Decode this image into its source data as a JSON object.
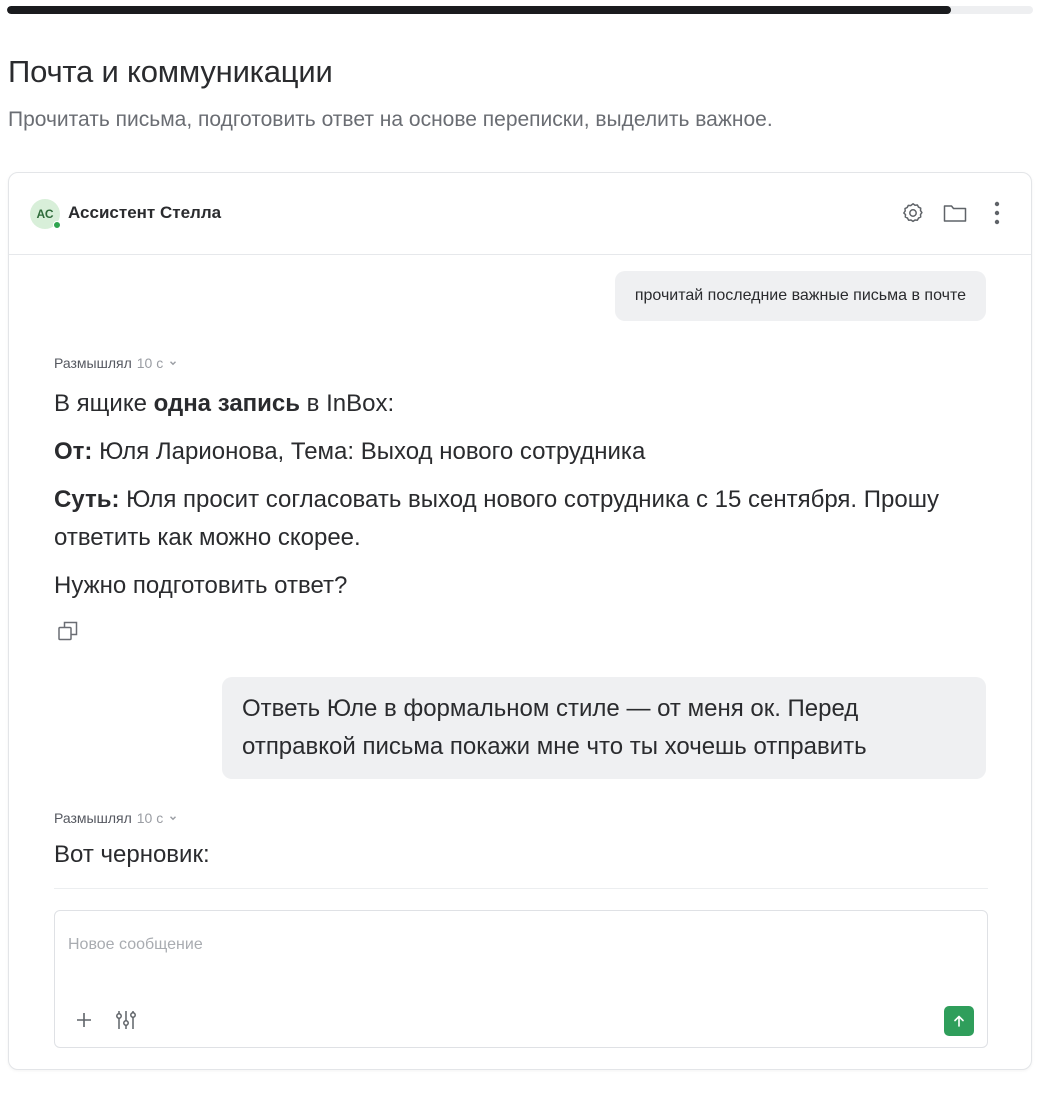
{
  "progress": {
    "fraction": 0.92,
    "color": "#1a1b1e"
  },
  "page": {
    "title": "Почта и коммуникации",
    "subtitle": "Прочитать письма, подготовить ответ на основе переписки, выделить важное."
  },
  "chat": {
    "header": {
      "avatar_initials": "АС",
      "assistant_name": "Ассистент Стелла",
      "actions": [
        "settings-icon",
        "folder-icon",
        "more-vertical-icon"
      ]
    },
    "messages": {
      "user_1": "прочитай последние важные письма в почте",
      "thought_1": {
        "label": "Размышлял",
        "duration": "10 с"
      },
      "assistant_1": {
        "line1_prefix": "В ящике ",
        "line1_bold": "одна запись",
        "line1_suffix": " в InBox:",
        "from_label": "От:",
        "from_text": " Юля Ларионова, Тема: Выход нового сотрудника",
        "gist_label": "Суть:",
        "gist_text": " Юля просит согласовать выход нового сотрудника с 15 сентября. Прошу ответить как можно скорее.",
        "question": "Нужно подготовить ответ?"
      },
      "user_2": "Ответь Юле в формальном стиле — от меня ок. Перед отправкой письма покажи мне что ты хочешь отправить",
      "thought_2": {
        "label": "Размышлял",
        "duration": "10 с"
      },
      "assistant_2": "Вот черновик:"
    },
    "composer": {
      "placeholder": "Новое сообщение",
      "tools": [
        "plus-icon",
        "sliders-icon"
      ],
      "send_icon": "arrow-up-icon",
      "send_color": "#2f9e5b"
    }
  }
}
